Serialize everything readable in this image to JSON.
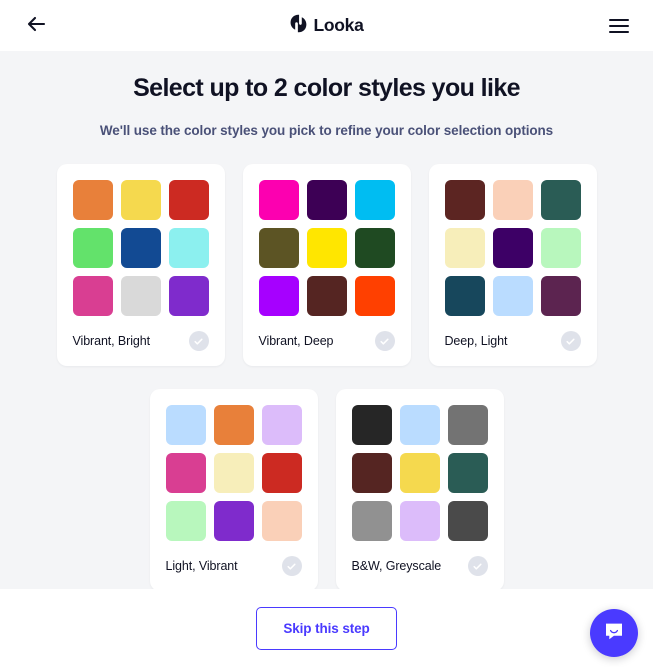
{
  "header": {
    "back_icon": "arrow-left-icon",
    "brand_name": "Looka",
    "brand_mark_icon": "looka-logo-icon",
    "menu_icon": "hamburger-menu-icon"
  },
  "main": {
    "title": "Select up to 2 color styles you like",
    "subtitle": "We'll use the color styles you pick to refine your color selection options"
  },
  "cards": [
    {
      "label": "Vibrant, Bright",
      "check_icon": "check-circle-icon",
      "selected": false,
      "swatches": [
        "#e8803a",
        "#f5d94e",
        "#cc2a22",
        "#63e26b",
        "#124a93",
        "#8cf0ef",
        "#d93e92",
        "#d9d9d9",
        "#7f2bcc"
      ]
    },
    {
      "label": "Vibrant, Deep",
      "check_icon": "check-circle-icon",
      "selected": false,
      "swatches": [
        "#fc00b0",
        "#3d0055",
        "#00bdf2",
        "#5c5424",
        "#ffe600",
        "#1f4a22",
        "#a600ff",
        "#552522",
        "#ff4000"
      ]
    },
    {
      "label": "Deep, Light",
      "check_icon": "check-circle-icon",
      "selected": false,
      "swatches": [
        "#5c2522",
        "#fad0b8",
        "#2a5c55",
        "#f7eeba",
        "#3d0066",
        "#b8f7bd",
        "#17475c",
        "#badcff",
        "#5c2450"
      ]
    },
    {
      "label": "Light, Vibrant",
      "check_icon": "check-circle-icon",
      "selected": false,
      "swatches": [
        "#badcff",
        "#e8803a",
        "#dcbcfa",
        "#d93e92",
        "#f7eeba",
        "#cc2a22",
        "#b8f7bd",
        "#7f2bcc",
        "#fad0b8"
      ]
    },
    {
      "label": "B&W, Greyscale",
      "check_icon": "check-circle-icon",
      "selected": false,
      "swatches": [
        "#262626",
        "#badcff",
        "#737373",
        "#552522",
        "#f5d94e",
        "#2a5c55",
        "#919191",
        "#dcbcfa",
        "#4a4a4a"
      ]
    }
  ],
  "footer": {
    "skip_label": "Skip this step"
  },
  "chat": {
    "icon": "chat-bubble-icon"
  },
  "colors": {
    "accent": "#4a3aff",
    "page_bg": "#f4f5f7",
    "card_bg": "#ffffff",
    "text": "#101223",
    "subtitle": "#4a5178",
    "check_bg": "#dfe2ea"
  }
}
